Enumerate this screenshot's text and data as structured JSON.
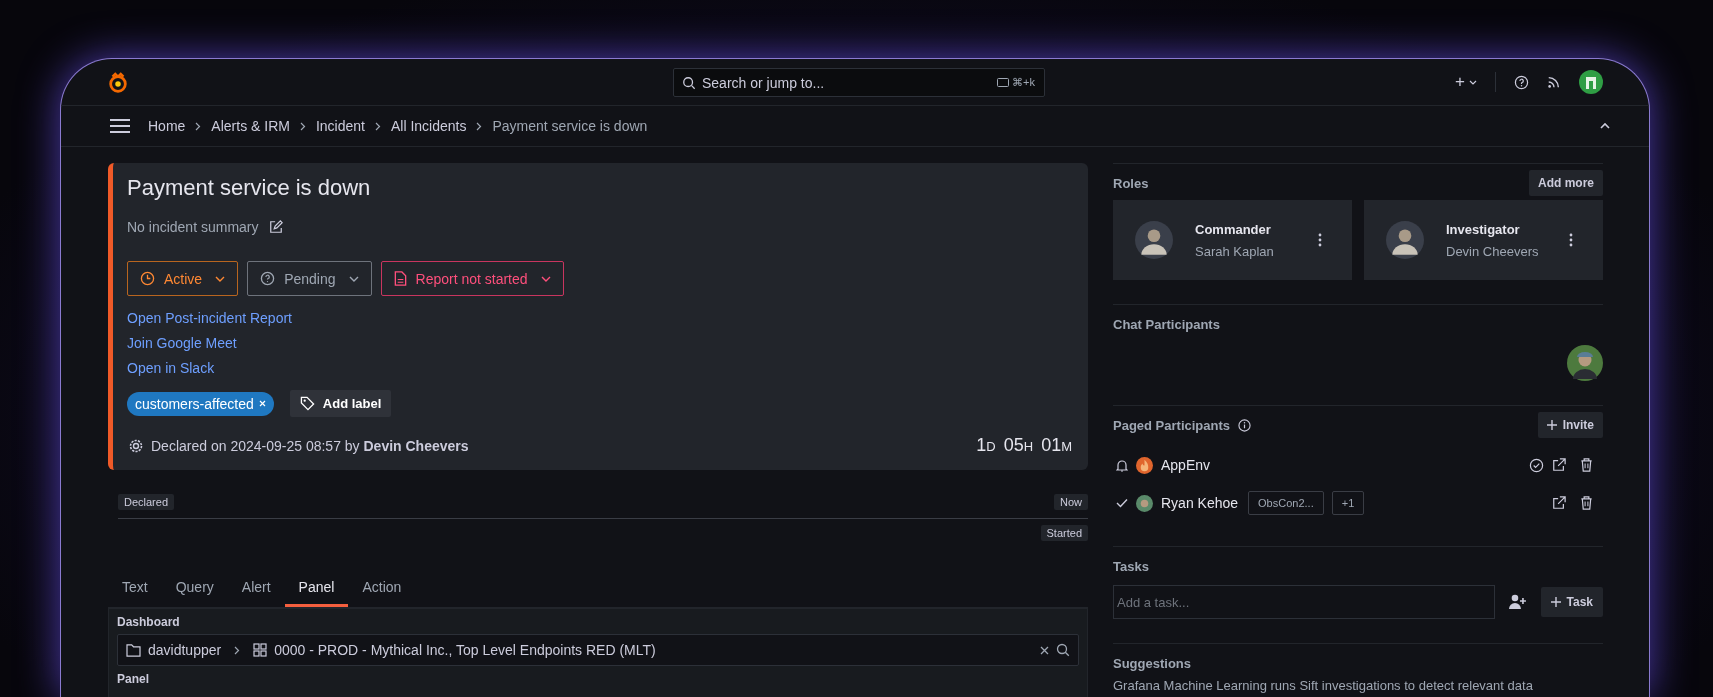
{
  "topbar": {
    "search": {
      "placeholder": "Search or jump to...",
      "shortcut": "⌘+k"
    },
    "new_caret": "+"
  },
  "breadcrumbs": [
    {
      "label": "Home",
      "current": false
    },
    {
      "label": "Alerts & IRM",
      "current": false
    },
    {
      "label": "Incident",
      "current": false
    },
    {
      "label": "All Incidents",
      "current": false
    },
    {
      "label": "Payment service is down",
      "current": true
    }
  ],
  "incident": {
    "title": "Payment service is down",
    "summary": "No incident summary",
    "status_buttons": [
      {
        "label": "Active",
        "kind": "status"
      },
      {
        "label": "Pending",
        "kind": "severity"
      },
      {
        "label": "Report not started",
        "kind": "report"
      }
    ],
    "links": [
      "Open Post-incident Report",
      "Join Google Meet",
      "Open in Slack"
    ],
    "labels": [
      {
        "text": "customers-affected",
        "color": "#1f78c1"
      }
    ],
    "add_label": "Add label",
    "declared": "Declared on 2024-09-25 08:57 by **Devin Cheevers**",
    "duration": [
      {
        "value": "1",
        "unit": "D"
      },
      {
        "value": "05",
        "unit": "H"
      },
      {
        "value": "01",
        "unit": "M"
      }
    ]
  },
  "timeline": {
    "markers": [
      {
        "label": "Declared",
        "kind": "start"
      },
      {
        "label": "Now",
        "kind": "end-top"
      },
      {
        "label": "Started",
        "kind": "end-bottom"
      }
    ]
  },
  "tabs": [
    {
      "label": "Text",
      "selected": false
    },
    {
      "label": "Query",
      "selected": false
    },
    {
      "label": "Alert",
      "selected": false
    },
    {
      "label": "Panel",
      "selected": true
    },
    {
      "label": "Action",
      "selected": false
    }
  ],
  "dashboard": {
    "label": "Dashboard",
    "folder": "davidtupper",
    "name": "0000 - PROD - Mythical Inc., Top Level Endpoints RED (MLT)",
    "panel_label": "Panel"
  },
  "roles": {
    "title": "Roles",
    "add_button": "Add more",
    "items": [
      {
        "role": "Commander",
        "name": "Sarah Kaplan"
      },
      {
        "role": "Investigator",
        "name": "Devin Cheevers"
      }
    ]
  },
  "chat": {
    "title": "Chat Participants"
  },
  "paged": {
    "title": "Paged Participants",
    "invite_button": "Invite",
    "items": [
      {
        "name": "AppEnv",
        "kind": "escalation"
      },
      {
        "name": "Ryan Kehoe",
        "kind": "user",
        "tags": [
          "ObsCon2...",
          "+1"
        ]
      }
    ]
  },
  "tasks": {
    "title": "Tasks",
    "placeholder": "Add a task...",
    "button": "Task"
  },
  "suggestions": {
    "title": "Suggestions",
    "text": "Grafana Machine Learning runs Sift investigations to detect relevant data"
  }
}
